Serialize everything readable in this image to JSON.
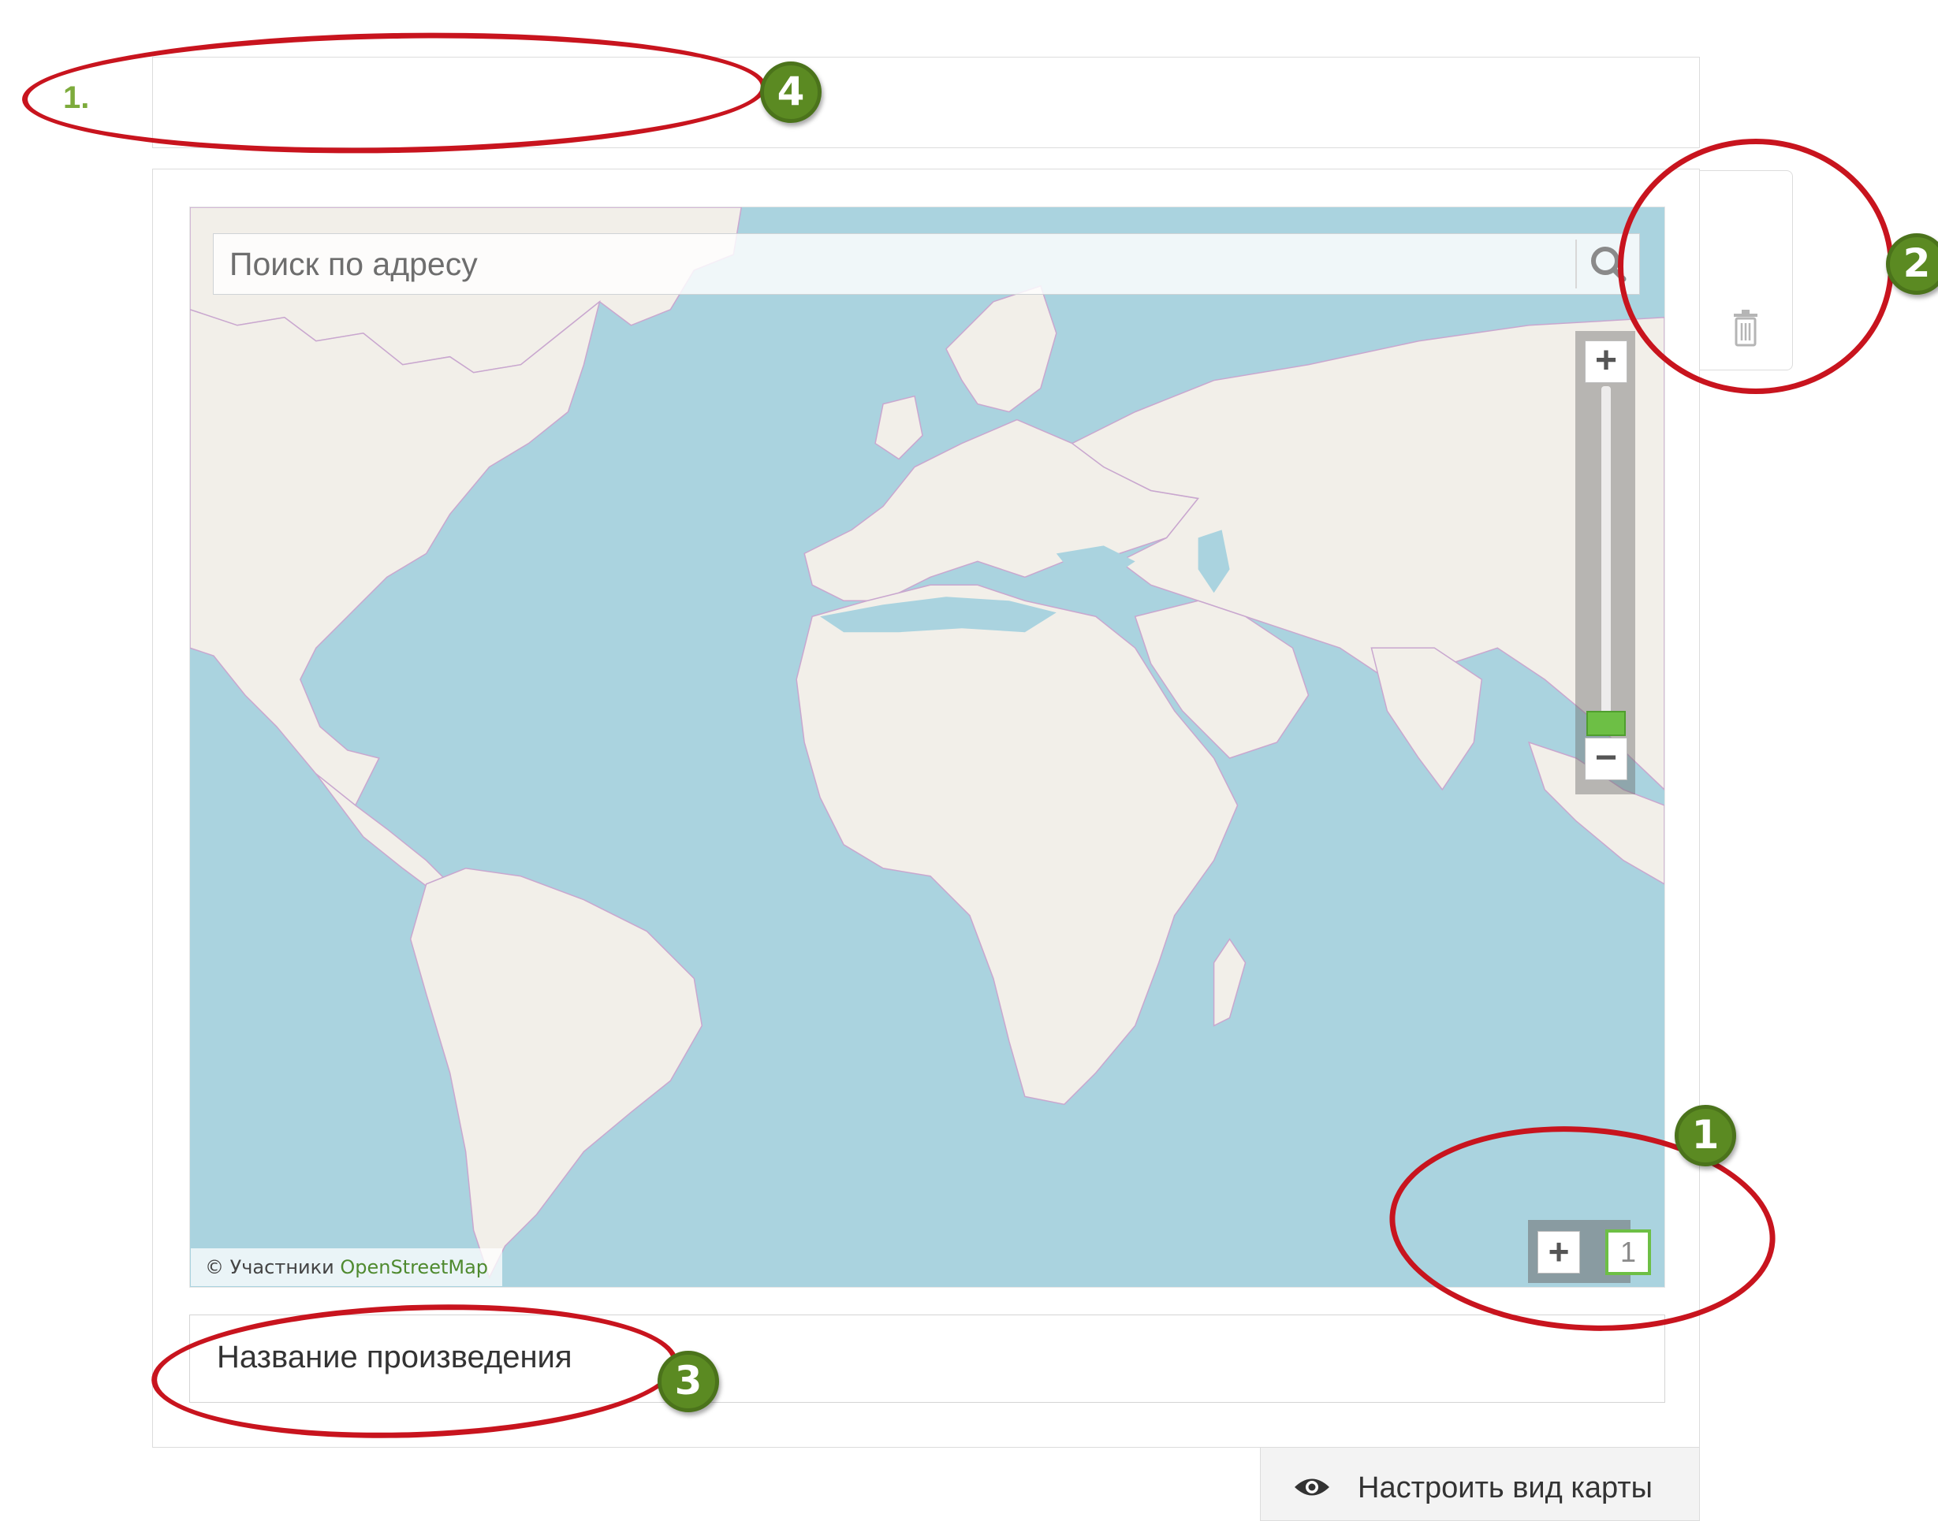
{
  "form_row": {
    "number": "1."
  },
  "map": {
    "search": {
      "placeholder": "Поиск по адресу"
    },
    "zoom": {
      "in_label": "+",
      "out_label": "−"
    },
    "attribution": {
      "prefix": "© Участники",
      "link": "OpenStreetMap"
    },
    "control": {
      "add_label": "+",
      "count": "1"
    }
  },
  "title_field": {
    "value": "Название произведения"
  },
  "configure_button": {
    "label": "Настроить вид карты"
  },
  "annotations": {
    "badge_1": "1",
    "badge_2": "2",
    "badge_3": "3",
    "badge_4": "4"
  },
  "colors": {
    "annotation_red": "#c8141e",
    "badge_green": "#5b8a22",
    "accent_green": "#6dbf45",
    "water": "#aad3df",
    "land": "#f2efe9"
  },
  "icons": [
    "search-icon",
    "trash-icon",
    "eye-icon",
    "plus-icon",
    "minus-icon"
  ]
}
